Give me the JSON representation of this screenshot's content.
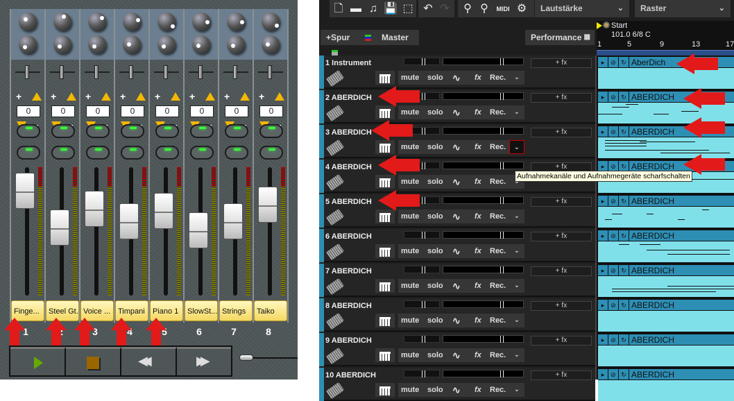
{
  "mixer": {
    "channels": [
      {
        "num": "1",
        "name": "Finge...",
        "value": "0",
        "fader": 0.92
      },
      {
        "num": "2",
        "name": "Steel Gt.",
        "value": "0",
        "fader": 0.68
      },
      {
        "num": "3",
        "name": "Voice ...",
        "value": "0",
        "fader": 0.8
      },
      {
        "num": "4",
        "name": "Timpani",
        "value": "0",
        "fader": 0.72
      },
      {
        "num": "5",
        "name": "Piano 1",
        "value": "0",
        "fader": 0.79
      },
      {
        "num": "6",
        "name": "SlowSt...",
        "value": "0",
        "fader": 0.66
      },
      {
        "num": "7",
        "name": "Strings",
        "value": "0",
        "fader": 0.72
      },
      {
        "num": "8",
        "name": "Taiko",
        "value": "0",
        "fader": 0.83
      }
    ],
    "transport": {
      "play": "play",
      "stop": "stop",
      "rewind": "rewind",
      "forward": "fast-forward"
    }
  },
  "daw": {
    "toolbar": {
      "icons": [
        "new-file",
        "open-folder",
        "open-music",
        "save",
        "crop",
        "undo",
        "redo",
        "zoom-in",
        "zoom-out",
        "midi",
        "settings"
      ],
      "midi_label": "MIDI",
      "dropdown1": "Lautstärke",
      "dropdown2": "Raster"
    },
    "header": {
      "add_track": "+Spur",
      "master": "Master",
      "performance": "Performance"
    },
    "ruler": {
      "marker": "Start",
      "tempo": "101.0 6/8 C",
      "ticks": [
        "1",
        "5",
        "9",
        "13",
        "17"
      ]
    },
    "track_controls": {
      "mute": "mute",
      "solo": "solo",
      "fx": "fx",
      "rec": "Rec.",
      "add_fx": "+ fx"
    },
    "tracks": [
      {
        "name": "1 Instrument",
        "clip": "AberDich"
      },
      {
        "name": "2 ABERDICH",
        "clip": "ABERDICH"
      },
      {
        "name": "3 ABERDICH",
        "clip": "ABERDICH"
      },
      {
        "name": "4 ABERDICH",
        "clip": "ABERDICH"
      },
      {
        "name": "5 ABERDICH",
        "clip": "ABERDICH"
      },
      {
        "name": "6 ABERDICH",
        "clip": "ABERDICH"
      },
      {
        "name": "7 ABERDICH",
        "clip": "ABERDICH"
      },
      {
        "name": "8 ABERDICH",
        "clip": "ABERDICH"
      },
      {
        "name": "9 ABERDICH",
        "clip": "ABERDICH"
      },
      {
        "name": "10 ABERDICH",
        "clip": "ABERDICH"
      }
    ],
    "tooltip": "Aufnahmekanäle und Aufnahmegeräte scharfschalten"
  },
  "colors": {
    "accent": "#2e8fb5",
    "clip": "#80e0ea",
    "annotation_arrow": "#e21a1a",
    "name_button": "#f5d860"
  }
}
